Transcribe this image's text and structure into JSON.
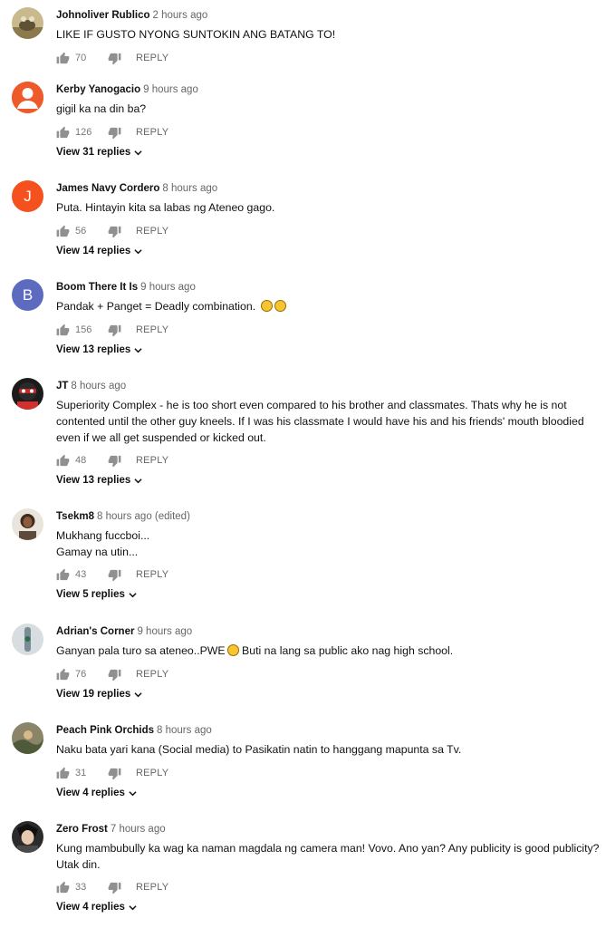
{
  "comments": [
    {
      "author": "Johnoliver Rublico",
      "time": "2 hours ago",
      "lines": [
        "LIKE IF GUSTO NYONG SUNTOKIN ANG BATANG TO!"
      ],
      "likes": "70",
      "reply_label": "REPLY",
      "view_replies": "",
      "avatar": {
        "icon": "image-avatar",
        "color": "#8c7a4e"
      }
    },
    {
      "author": "Kerby Yanogacio",
      "time": "9 hours ago",
      "lines": [
        "gigil ka na din ba?"
      ],
      "likes": "126",
      "reply_label": "REPLY",
      "view_replies": "View 31 replies",
      "avatar": {
        "icon": "person-avatar",
        "color": "#ef5a2a"
      }
    },
    {
      "author": "James Navy Cordero",
      "time": "8 hours ago",
      "lines": [
        "Puta. Hintayin kita sa labas ng Ateneo gago."
      ],
      "likes": "56",
      "reply_label": "REPLY",
      "view_replies": "View 14 replies",
      "avatar": {
        "icon": "letter-avatar",
        "letter": "J",
        "color": "#f4511e"
      }
    },
    {
      "author": "Boom There It Is",
      "time": "9 hours ago",
      "lines": [
        "Pandak + Panget = Deadly combination."
      ],
      "emoji_count": 2,
      "likes": "156",
      "reply_label": "REPLY",
      "view_replies": "View 13 replies",
      "avatar": {
        "icon": "letter-avatar",
        "letter": "B",
        "color": "#5c6bc0"
      }
    },
    {
      "author": "JT",
      "time": "8 hours ago",
      "lines": [
        "Superiority Complex - he is too short even compared to his brother and classmates. Thats why he is not",
        "contented until the other guy kneels. If I was his classmate I would have his and his friends' mouth bloodied",
        "even if we all get suspended or kicked out."
      ],
      "likes": "48",
      "reply_label": "REPLY",
      "view_replies": "View 13 replies",
      "avatar": {
        "icon": "image-avatar",
        "color": "#1b1b1b"
      }
    },
    {
      "author": "Tsekm8",
      "time": "8 hours ago (edited)",
      "lines": [
        "Mukhang fuccboi...",
        "Gamay na utin..."
      ],
      "likes": "43",
      "reply_label": "REPLY",
      "view_replies": "View 5 replies",
      "avatar": {
        "icon": "image-avatar",
        "color": "#b9b2a8"
      }
    },
    {
      "author": "Adrian's Corner",
      "time": "9 hours ago",
      "lines": [
        "Ganyan pala turo sa ateneo..PWE",
        "Buti na lang sa public ako nag high school."
      ],
      "inline_emoji_after_first": true,
      "likes": "76",
      "reply_label": "REPLY",
      "view_replies": "View 19 replies",
      "avatar": {
        "icon": "image-avatar",
        "color": "#cfd8dc"
      }
    },
    {
      "author": "Peach Pink Orchids",
      "time": "8 hours ago",
      "lines": [
        "Naku bata yari kana (Social media) to Pasikatin natin to hanggang mapunta sa Tv."
      ],
      "likes": "31",
      "reply_label": "REPLY",
      "view_replies": "View 4 replies",
      "avatar": {
        "icon": "image-avatar",
        "color": "#6d6a5a"
      }
    },
    {
      "author": "Zero Frost",
      "time": "7 hours ago",
      "lines": [
        "Kung mambubully ka wag ka naman magdala ng camera man! Vovo. Ano yan?  Any publicity is good publicity?",
        "Utak din."
      ],
      "likes": "33",
      "reply_label": "REPLY",
      "view_replies": "View 4 replies",
      "avatar": {
        "icon": "image-avatar",
        "color": "#3a3a3a"
      }
    }
  ]
}
